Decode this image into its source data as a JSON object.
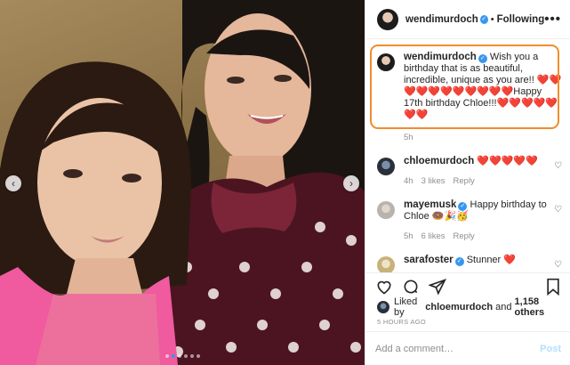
{
  "header": {
    "username": "wendimurdoch",
    "separator": "•",
    "follow_status": "Following",
    "more_icon": "more-dots-icon"
  },
  "caption": {
    "username": "wendimurdoch",
    "text": "Wish you a birthday that is as beautiful, incredible, unique as you are!! ❤️❤️❤️❤️❤️❤️❤️❤️❤️❤️❤️Happy 17th birthday Chloe!!!❤️❤️❤️❤️❤️❤️❤️",
    "time": "5h"
  },
  "comments": [
    {
      "username": "chloemurdoch",
      "verified": false,
      "text": "❤️❤️❤️❤️❤️",
      "time": "4h",
      "likes": "3 likes",
      "reply": "Reply"
    },
    {
      "username": "mayemusk",
      "verified": true,
      "text": "Happy birthday to Chloe 🍩🎉🥳",
      "time": "5h",
      "likes": "6 likes",
      "reply": "Reply"
    },
    {
      "username": "sarafoster",
      "verified": true,
      "text": "Stunner ❤️",
      "time": "",
      "likes": "",
      "reply": ""
    }
  ],
  "likes": {
    "prefix": "Liked by",
    "user": "chloemurdoch",
    "joiner": "and",
    "others": "1,158 others"
  },
  "timestamp": "5 HOURS AGO",
  "add_comment": {
    "placeholder": "Add a comment…",
    "post_label": "Post"
  },
  "carousel": {
    "prev_icon": "chevron-left-icon",
    "next_icon": "chevron-right-icon",
    "prev_glyph": "‹",
    "next_glyph": "›",
    "dot_count": 6,
    "active_dot": 1
  },
  "colors": {
    "highlight_border": "#f28c2b",
    "verified_blue": "#3897f0",
    "post_button": "#b2dffc",
    "muted_text": "#8e8e8e"
  }
}
